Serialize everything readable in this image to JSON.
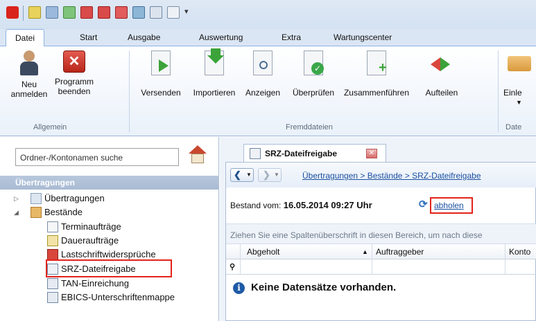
{
  "ribbon_tabs": [
    "Datei",
    "Start",
    "Ausgabe",
    "Auswertung",
    "Extra",
    "Wartungscenter"
  ],
  "ribbon": {
    "allgemein": {
      "label": "Allgemein",
      "buttons": [
        {
          "line1": "Neu",
          "line2": "anmelden",
          "icon": "user-icon"
        },
        {
          "line1": "Programm",
          "line2": "beenden",
          "icon": "close-program-icon"
        }
      ]
    },
    "fremddateien": {
      "label": "Fremddateien",
      "buttons": [
        {
          "label": "Versenden",
          "icon": "send-file-icon"
        },
        {
          "label": "Importieren",
          "icon": "import-file-icon"
        },
        {
          "label": "Anzeigen",
          "icon": "view-file-icon"
        },
        {
          "label": "Überprüfen",
          "icon": "check-file-icon"
        },
        {
          "label": "Zusammenführen",
          "icon": "merge-file-icon"
        },
        {
          "label": "Aufteilen",
          "icon": "split-file-icon"
        }
      ]
    },
    "dateien": {
      "label": "Date",
      "button": "Einle",
      "icon": "folder-icon"
    }
  },
  "sidebar": {
    "search_placeholder": "Ordner-/Kontonamen suche",
    "header": "Übertragungen",
    "items": [
      {
        "label": "Übertragungen",
        "icon": "mail-folder-icon",
        "level": 0,
        "toggle": "▷"
      },
      {
        "label": "Bestände",
        "icon": "bestaende-folder-icon",
        "level": 0,
        "toggle": "◢"
      },
      {
        "label": "Terminaufträge",
        "icon": "calendar-icon",
        "level": 1
      },
      {
        "label": "Daueraufträge",
        "icon": "standing-order-icon",
        "level": 1
      },
      {
        "label": "Lastschriftwidersprüche",
        "icon": "direct-debit-icon",
        "level": 1
      },
      {
        "label": "SRZ-Dateifreigabe",
        "icon": "file-release-icon",
        "level": 1
      },
      {
        "label": "TAN-Einreichung",
        "icon": "tan-icon",
        "level": 1
      },
      {
        "label": "EBICS-Unterschriftenmappe",
        "icon": "signature-icon",
        "level": 1
      }
    ]
  },
  "document": {
    "tab_label": "SRZ-Dateifreigabe",
    "breadcrumb": "Übertragungen > Bestände > SRZ-Dateifreigabe",
    "bestand_label": "Bestand vom:",
    "bestand_value": "16.05.2014 09:27 Uhr",
    "fetch_link": "abholen",
    "group_hint": "Ziehen Sie eine Spaltenüberschrift in diesen Bereich, um nach diese",
    "columns": [
      "Abgeholt",
      "Auftraggeber",
      "Konto"
    ],
    "sort_indicator": "▲",
    "empty_message": "Keine Datensätze vorhanden."
  },
  "colors": {
    "highlight": "#e2231a",
    "link": "#1a4fa0"
  }
}
